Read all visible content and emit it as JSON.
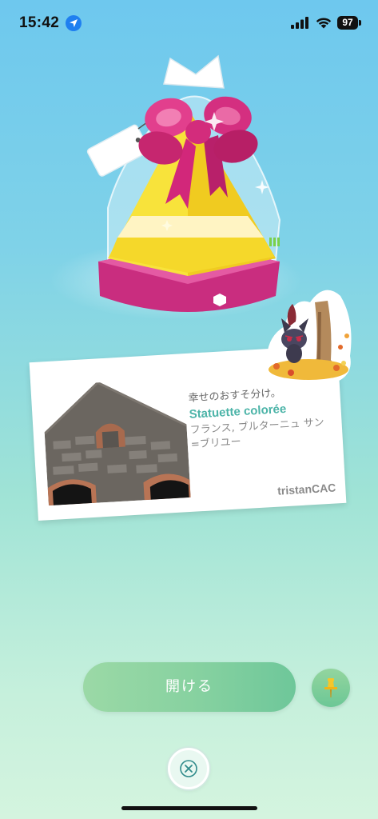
{
  "status_bar": {
    "time": "15:42",
    "battery": "97",
    "icons": [
      "location-arrow-icon",
      "cellular-signal-icon",
      "wifi-icon",
      "battery-icon"
    ]
  },
  "gift": {
    "icon": "gift-icon",
    "colors": {
      "bow": "#d6307a",
      "body": "#f7e23a",
      "band": "#fff6c6",
      "base": "#d02f86"
    }
  },
  "postcard": {
    "line1": "幸せのおすそ分け。",
    "title": "Statuette colorée",
    "location": "フランス, ブルターニュ サン=ブリユー",
    "sender": "tristanCAC",
    "title_color": "#4cb4a8"
  },
  "sticker": {
    "icon": "zorua-autumn-sticker-icon"
  },
  "actions": {
    "open_label": "開ける",
    "pin_icon": "pushpin-icon",
    "close_icon": "close-icon"
  },
  "colors": {
    "background_top": "#6ec8ee",
    "background_bottom": "#d4f4df",
    "button_green": "#86d1a0"
  }
}
